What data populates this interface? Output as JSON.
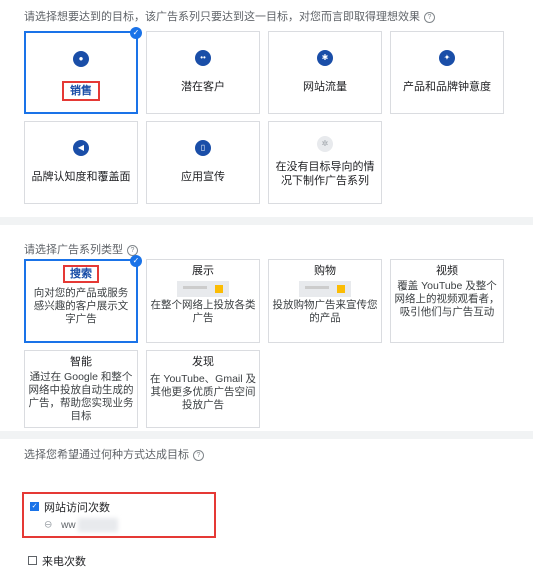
{
  "goals_section": {
    "title": "请选择想要达到的目标，该广告系列只要达到这一目标，对您而言即取得理想效果",
    "cards": [
      {
        "label": "销售",
        "icon": "sales-tag-icon",
        "selected": true
      },
      {
        "label": "潜在客户",
        "icon": "people-icon",
        "selected": false
      },
      {
        "label": "网站流量",
        "icon": "cursor-click-icon",
        "selected": false
      },
      {
        "label": "产品和品牌钟意度",
        "icon": "sparkle-icon",
        "selected": false
      },
      {
        "label": "品牌认知度和覆盖面",
        "icon": "megaphone-icon",
        "selected": false
      },
      {
        "label": "应用宣传",
        "icon": "phone-icon",
        "selected": false
      },
      {
        "label": "在没有目标导向的情况下制作广告系列",
        "icon": "gear-icon",
        "selected": false
      }
    ]
  },
  "type_section": {
    "title": "请选择广告系列类型",
    "cards": [
      {
        "title": "搜索",
        "desc": "向对您的产品或服务感兴趣的客户展示文字广告",
        "selected": true
      },
      {
        "title": "展示",
        "desc": "在整个网络上投放各类广告",
        "selected": false
      },
      {
        "title": "购物",
        "desc": "投放购物广告来宣传您的产品",
        "selected": false
      },
      {
        "title": "视频",
        "desc": "覆盖 YouTube 及整个网络上的视频观看者，吸引他们与广告互动",
        "selected": false
      },
      {
        "title": "智能",
        "desc": "通过在 Google 和整个网络中投放自动生成的广告，帮助您实现业务目标",
        "selected": false
      },
      {
        "title": "发现",
        "desc": "在 YouTube、Gmail 及其他更多优质广告空间投放广告",
        "selected": false
      }
    ]
  },
  "conversion_section": {
    "title": "选择您希望通过何种方式达成目标",
    "options": [
      {
        "label": "网站访问次数",
        "checked": true,
        "sub_value": "ww"
      },
      {
        "label": "来电次数",
        "checked": false
      }
    ]
  },
  "colors": {
    "accent": "#1a73e8",
    "highlight": "#e53935",
    "icon_blue": "#1a4ea8"
  }
}
